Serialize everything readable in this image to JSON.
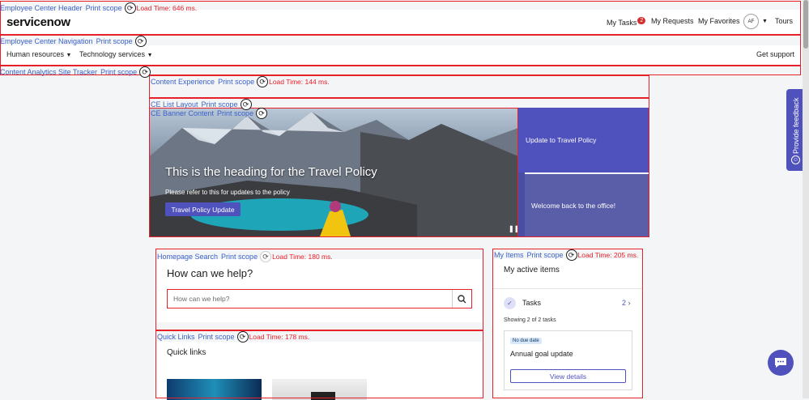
{
  "debug": {
    "print_scope_label": "Print scope",
    "header_label": "Employee Center Header",
    "header_load": "Load Time: 646 ms.",
    "nav_label": "Employee Center Navigation",
    "tracker_label": "Content Analytics Site Tracker",
    "content_exp_label": "Content Experience",
    "content_exp_load": "Load Time: 144 ms.",
    "list_layout_label": "CE List Layout",
    "banner_label": "CE Banner Content",
    "search_label": "Homepage Search",
    "search_load": "Load Time: 180 ms.",
    "myitems_label": "My Items",
    "myitems_load": "Load Time: 205 ms.",
    "quicklinks_label": "Quick Links",
    "quicklinks_load": "Load Time: 178 ms."
  },
  "header": {
    "logo": "servicenow",
    "my_tasks": "My Tasks",
    "my_tasks_count": "2",
    "my_requests": "My Requests",
    "my_favorites": "My Favorites",
    "avatar_initials": "AF",
    "tours": "Tours"
  },
  "nav": {
    "human_resources": "Human resources",
    "technology_services": "Technology services",
    "get_support": "Get support"
  },
  "banner": {
    "title": "This is the heading for the Travel Policy",
    "subtitle": "Please refer to this for updates to the policy",
    "button": "Travel Policy Update",
    "side_card_1": "Update to Travel Policy",
    "side_card_2": "Welcome back to the office!"
  },
  "search": {
    "title": "How can we help?",
    "placeholder": "How can we help?"
  },
  "my_items": {
    "title": "My active items",
    "tasks_label": "Tasks",
    "tasks_count": "2",
    "showing": "Showing 2 of 2 tasks",
    "pill": "No due date",
    "task_title": "Annual goal update",
    "view_button": "View details"
  },
  "quick_links": {
    "title": "Quick links"
  },
  "feedback": {
    "label": "Provide feedback"
  },
  "colors": {
    "accent": "#4f52bd",
    "debug_border": "#e8202a",
    "debug_link": "#3a62c9"
  }
}
